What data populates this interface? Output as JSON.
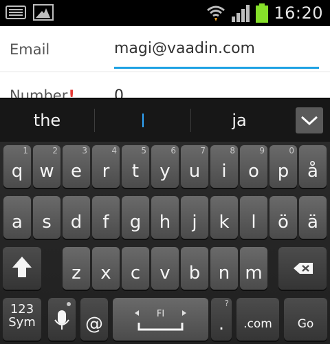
{
  "status_bar": {
    "time": "16:20",
    "icons": [
      "keyboard-icon",
      "image-icon",
      "wifi-icon",
      "signal-icon",
      "battery-icon"
    ],
    "battery_color": "#86e02a"
  },
  "form": {
    "email": {
      "label": "Email",
      "value": "magi@vaadin.com"
    },
    "number": {
      "label": "Number",
      "required_mark": "!",
      "value": "0"
    }
  },
  "suggestions": [
    "the",
    "",
    "ja"
  ],
  "keyboard": {
    "row1": [
      {
        "ch": "q",
        "num": "1"
      },
      {
        "ch": "w",
        "num": "2"
      },
      {
        "ch": "e",
        "num": "3"
      },
      {
        "ch": "r",
        "num": "4"
      },
      {
        "ch": "t",
        "num": "5"
      },
      {
        "ch": "y",
        "num": "6"
      },
      {
        "ch": "u",
        "num": "7"
      },
      {
        "ch": "i",
        "num": "8"
      },
      {
        "ch": "o",
        "num": "9"
      },
      {
        "ch": "p",
        "num": "0"
      },
      {
        "ch": "å",
        "num": ""
      }
    ],
    "row2": [
      "a",
      "s",
      "d",
      "f",
      "g",
      "h",
      "j",
      "k",
      "l",
      "ö",
      "ä"
    ],
    "row3": [
      "z",
      "x",
      "c",
      "v",
      "b",
      "n",
      "m"
    ],
    "sym_line1": "123",
    "sym_line2": "Sym",
    "at": "@",
    "space_label": "FI",
    "period": ".",
    "period_hint": "?",
    "dotcom": ".com",
    "go": "Go",
    "accent_color": "#1da1e3"
  }
}
